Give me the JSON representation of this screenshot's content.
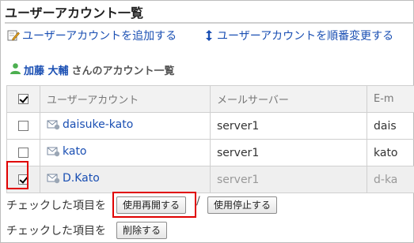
{
  "page": {
    "title": "ユーザーアカウント一覧"
  },
  "actions": {
    "add_label": "ユーザーアカウントを追加する",
    "reorder_label": "ユーザーアカウントを順番変更する"
  },
  "user": {
    "name": "加藤 大輔",
    "suffix": "さんのアカウント一覧"
  },
  "table": {
    "columns": [
      "ユーザーアカウント",
      "メールサーバー",
      "E-m"
    ],
    "rows": [
      {
        "account": "daisuke-kato",
        "server": "server1",
        "email": "dais",
        "checked": false,
        "disabled": false
      },
      {
        "account": "kato",
        "server": "server1",
        "email": "kato",
        "checked": false,
        "disabled": false
      },
      {
        "account": "D.Kato",
        "server": "server1",
        "email": "d-ka",
        "checked": true,
        "disabled": true
      }
    ]
  },
  "footer": {
    "checked_items_label": "チェックした項目を",
    "resume_label": "使用再開する",
    "separator": "/",
    "stop_label": "使用停止する",
    "delete_label": "削除する"
  },
  "colors": {
    "link": "#1a4fb3",
    "highlight": "#e00000",
    "header_bg": "#f2f2f2",
    "disabled_row_bg": "#efefef"
  }
}
